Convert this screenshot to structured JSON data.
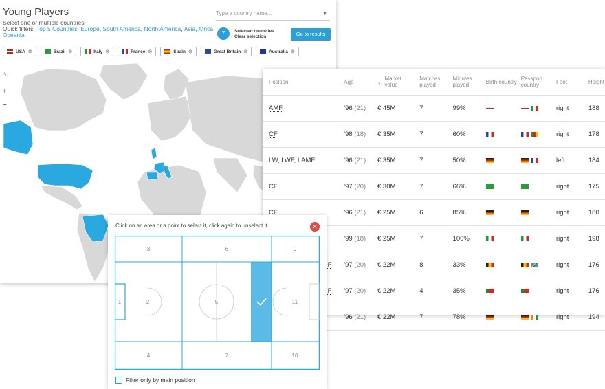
{
  "header": {
    "title": "Young Players",
    "subtitle": "Select one or multiple countries",
    "quick_filters_label": "Quick filters:",
    "quick_filters": [
      "Top 5 Countries",
      "Europe",
      "South America",
      "North America",
      "Asia",
      "Africa",
      "Oceania"
    ]
  },
  "search": {
    "placeholder": "Type a country name..."
  },
  "selection": {
    "count": "7",
    "label": "Selected countries",
    "clear": "Clear selection"
  },
  "go_button": "Go to results",
  "chips": [
    {
      "label": "USA",
      "flag": "usa"
    },
    {
      "label": "Brazil",
      "flag": "brazil"
    },
    {
      "label": "Italy",
      "flag": "italy"
    },
    {
      "label": "France",
      "flag": "france"
    },
    {
      "label": "Spain",
      "flag": "spain"
    },
    {
      "label": "Great Britain",
      "flag": "gb"
    },
    {
      "label": "Australia",
      "flag": "australia"
    }
  ],
  "map_controls": {
    "home": "home-icon",
    "zoom_in": "+",
    "zoom_out": "−"
  },
  "colors": {
    "accent": "#2a9fd8",
    "map_land": "#d8d8d8",
    "map_selected": "#2aa8e0",
    "close": "#e04a3f"
  },
  "table": {
    "columns": [
      "Position",
      "Age",
      "Market value",
      "Matches played",
      "Minutes played",
      "Birth country",
      "Passport country",
      "Foot",
      "Height"
    ],
    "sort_icon": "↓",
    "rows": [
      {
        "position": "AMF",
        "year": "'96",
        "age": "(21)",
        "value": "€ 45M",
        "matches": "7",
        "minutes": "99%",
        "birth": [
          "england"
        ],
        "passport": [
          "england",
          "italy"
        ],
        "foot": "right",
        "height": "188"
      },
      {
        "position": "CF",
        "year": "'98",
        "age": "(18)",
        "value": "€ 35M",
        "matches": "7",
        "minutes": "60%",
        "birth": [
          "france"
        ],
        "passport": [
          "france",
          "cameroon"
        ],
        "foot": "right",
        "height": "178"
      },
      {
        "position": "LW, LWF, LAMF",
        "year": "'96",
        "age": "(21)",
        "value": "€ 35M",
        "matches": "7",
        "minutes": "50%",
        "birth": [
          "germany"
        ],
        "passport": [
          "germany",
          "france"
        ],
        "foot": "left",
        "height": "184"
      },
      {
        "position": "CF",
        "year": "'97",
        "age": "(20)",
        "value": "€ 30M",
        "matches": "7",
        "minutes": "66%",
        "birth": [
          "brazil"
        ],
        "passport": [
          "brazil"
        ],
        "foot": "right",
        "height": "175"
      },
      {
        "position": "CF",
        "year": "'96",
        "age": "(21)",
        "value": "€ 25M",
        "matches": "6",
        "minutes": "85%",
        "birth": [
          "germany"
        ],
        "passport": [
          "germany"
        ],
        "foot": "right",
        "height": "180"
      },
      {
        "position": "",
        "year": "'99",
        "age": "(18)",
        "value": "€ 25M",
        "matches": "7",
        "minutes": "100%",
        "birth": [
          "italy"
        ],
        "passport": [
          "italy"
        ],
        "foot": "right",
        "height": "198"
      },
      {
        "position": "IF",
        "year": "'97",
        "age": "(20)",
        "value": "€ 22M",
        "matches": "8",
        "minutes": "33%",
        "birth": [
          "belgium"
        ],
        "passport": [
          "belgium",
          "congo"
        ],
        "foot": "right",
        "height": "176"
      },
      {
        "position": "IF",
        "year": "'97",
        "age": "(20)",
        "value": "€ 22M",
        "matches": "4",
        "minutes": "35%",
        "birth": [
          "portugal"
        ],
        "passport": [
          "portugal"
        ],
        "foot": "right",
        "height": "176"
      },
      {
        "position": "",
        "year": "'96",
        "age": "(21)",
        "value": "€ 22M",
        "matches": "7",
        "minutes": "78%",
        "birth": [
          "germany"
        ],
        "passport": [
          "germany",
          "ivory"
        ],
        "foot": "right",
        "height": "194"
      }
    ]
  },
  "pitch": {
    "instruction": "Click on an area or a point to select it, click again to unselect it.",
    "zones": [
      "1",
      "2",
      "3",
      "4",
      "5",
      "6",
      "7",
      "9",
      "10",
      "11"
    ],
    "selected_zone": "check-icon",
    "filter_label": "Filter only by main position"
  }
}
